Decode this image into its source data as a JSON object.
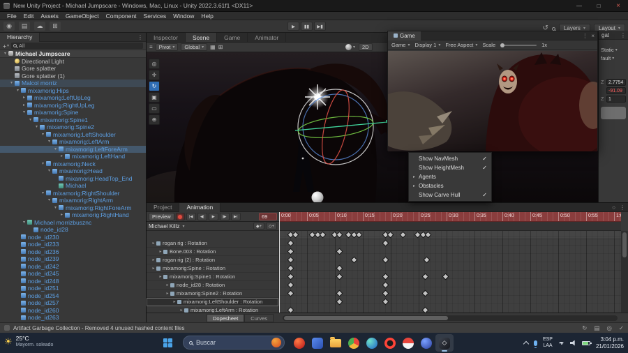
{
  "window": {
    "title": "New Unity Project - Michael Jumpscare - Windows, Mac, Linux - Unity 2022.3.61f1 <DX11>"
  },
  "icons": {
    "caret": "▾",
    "fold": "▸",
    "menu": "⋮",
    "close": "×",
    "minimize": "—",
    "maximize": "□",
    "check": "✓",
    "history": "↺",
    "hamburger": "≡",
    "plus": "+",
    "grid_snap": "▦",
    "increment_snap": "⊞",
    "key_add": "◆+",
    "event_add": "◇+",
    "lock": "○"
  },
  "menu_bar": {
    "items": [
      "File",
      "Edit",
      "Assets",
      "GameObject",
      "Component",
      "Services",
      "Window",
      "Help"
    ]
  },
  "toolbar": {
    "left_icons": [
      {
        "name": "account-icon",
        "glyph": "◉"
      },
      {
        "name": "services-icon",
        "glyph": "▤"
      },
      {
        "name": "cloud-icon",
        "glyph": "☁"
      },
      {
        "name": "grid-tool-icon",
        "glyph": "⊞"
      }
    ],
    "transport": [
      {
        "name": "play-button",
        "glyph": "▶"
      },
      {
        "name": "pause-button",
        "glyph": "▮▮"
      },
      {
        "name": "step-button",
        "glyph": "▶▮"
      }
    ],
    "layers_label": "Layers",
    "layout_label": "Layout"
  },
  "view_tabs": [
    {
      "label": "Inspector",
      "active": false
    },
    {
      "label": "Scene",
      "active": true
    },
    {
      "label": "Game",
      "active": false
    },
    {
      "label": "Animator",
      "active": false
    }
  ],
  "scene_toolbar": {
    "pivot_label": "Pivot",
    "global_label": "Global",
    "two_d_label": "2D"
  },
  "scene_tools": [
    {
      "name": "view-tool",
      "glyph": "◎",
      "active": false
    },
    {
      "name": "move-tool",
      "glyph": "✛",
      "active": false
    },
    {
      "name": "rotate-tool",
      "glyph": "↻",
      "active": true
    },
    {
      "name": "scale-tool",
      "glyph": "▣",
      "active": false
    },
    {
      "name": "rect-tool",
      "glyph": "▭",
      "active": false
    },
    {
      "name": "transform-tool",
      "glyph": "⊕",
      "active": false
    }
  ],
  "hierarchy": {
    "title": "Hierarchy",
    "search_value": "All",
    "items": [
      {
        "label": "Michael Jumpscare",
        "depth": 0,
        "arrow": "▾",
        "icon": "scene",
        "bold": true
      },
      {
        "label": "Directional Light",
        "depth": 1,
        "icon": "light"
      },
      {
        "label": "Gore splatter",
        "depth": 1,
        "icon": "go"
      },
      {
        "label": "Gore splatter (1)",
        "depth": 1,
        "icon": "go"
      },
      {
        "label": "Malcol morriz",
        "depth": 1,
        "arrow": "▾",
        "icon": "prefab",
        "prefab": true,
        "highlight": true
      },
      {
        "label": "mixamorig:Hips",
        "depth": 2,
        "arrow": "▾",
        "icon": "prefab",
        "prefab": true
      },
      {
        "label": "mixamorig:LeftUpLeg",
        "depth": 3,
        "arrow": "▸",
        "icon": "prefab",
        "prefab": true
      },
      {
        "label": "mixamorig:RightUpLeg",
        "depth": 3,
        "arrow": "▸",
        "icon": "prefab",
        "prefab": true
      },
      {
        "label": "mixamorig:Spine",
        "depth": 3,
        "arrow": "▾",
        "icon": "prefab",
        "prefab": true
      },
      {
        "label": "mixamorig:Spine1",
        "depth": 4,
        "arrow": "▾",
        "icon": "prefab",
        "prefab": true
      },
      {
        "label": "mixamorig:Spine2",
        "depth": 5,
        "arrow": "▾",
        "icon": "prefab",
        "prefab": true
      },
      {
        "label": "mixamorig:LeftShoulder",
        "depth": 6,
        "arrow": "▾",
        "icon": "prefab",
        "prefab": true
      },
      {
        "label": "mixamorig:LeftArm",
        "depth": 7,
        "arrow": "▾",
        "icon": "prefab",
        "prefab": true
      },
      {
        "label": "mixamorig:LeftForeArm",
        "depth": 8,
        "arrow": "▾",
        "icon": "prefab",
        "prefab": true,
        "selected": true
      },
      {
        "label": "mixamorig:LeftHand",
        "depth": 9,
        "arrow": "▸",
        "icon": "prefab",
        "prefab": true
      },
      {
        "label": "mixamorig:Neck",
        "depth": 6,
        "arrow": "▾",
        "icon": "prefab",
        "prefab": true
      },
      {
        "label": "mixamorig:Head",
        "depth": 7,
        "arrow": "▾",
        "icon": "prefab",
        "prefab": true
      },
      {
        "label": "mixamorig:HeadTop_End",
        "depth": 8,
        "icon": "prefab",
        "prefab": true
      },
      {
        "label": "Michael",
        "depth": 8,
        "icon": "mesh",
        "prefab": true
      },
      {
        "label": "mixamorig:RightShoulder",
        "depth": 6,
        "arrow": "▾",
        "icon": "prefab",
        "prefab": true
      },
      {
        "label": "mixamorig:RightArm",
        "depth": 7,
        "arrow": "▾",
        "icon": "prefab",
        "prefab": true
      },
      {
        "label": "mixamorig:RightForeArm",
        "depth": 8,
        "arrow": "▾",
        "icon": "prefab",
        "prefab": true
      },
      {
        "label": "mixamorig:RightHand",
        "depth": 9,
        "arrow": "▸",
        "icon": "prefab",
        "prefab": true
      },
      {
        "label": "Michael morrizbusznc",
        "depth": 3,
        "arrow": "▾",
        "icon": "mesh",
        "prefab": true
      },
      {
        "label": "node_id28",
        "depth": 4,
        "icon": "prefab",
        "prefab": true
      },
      {
        "label": "node_id230",
        "depth": 2,
        "icon": "prefab",
        "prefab": true
      },
      {
        "label": "node_id233",
        "depth": 2,
        "icon": "prefab",
        "prefab": true
      },
      {
        "label": "node_id236",
        "depth": 2,
        "icon": "prefab",
        "prefab": true
      },
      {
        "label": "node_id239",
        "depth": 2,
        "icon": "prefab",
        "prefab": true
      },
      {
        "label": "node_id242",
        "depth": 2,
        "icon": "prefab",
        "prefab": true
      },
      {
        "label": "node_id245",
        "depth": 2,
        "icon": "prefab",
        "prefab": true
      },
      {
        "label": "node_id248",
        "depth": 2,
        "icon": "prefab",
        "prefab": true
      },
      {
        "label": "node_id251",
        "depth": 2,
        "icon": "prefab",
        "prefab": true
      },
      {
        "label": "node_id254",
        "depth": 2,
        "icon": "prefab",
        "prefab": true
      },
      {
        "label": "node_id257",
        "depth": 2,
        "icon": "prefab",
        "prefab": true
      },
      {
        "label": "node_id260",
        "depth": 2,
        "icon": "prefab",
        "prefab": true
      },
      {
        "label": "node_id263",
        "depth": 2,
        "icon": "prefab",
        "prefab": true
      }
    ]
  },
  "game_window": {
    "tab_label": "Game",
    "mode_label": "Game",
    "display_label": "Display 1",
    "aspect_label": "Free Aspect",
    "scale_label": "Scale",
    "scale_value": "1x"
  },
  "navmesh_menu": {
    "items": [
      {
        "label": "Show NavMesh",
        "checked": true,
        "fold": false
      },
      {
        "label": "Show HeightMesh",
        "checked": true,
        "fold": false
      },
      {
        "label": "Agents",
        "checked": false,
        "fold": true
      },
      {
        "label": "Obstacles",
        "checked": false,
        "fold": true
      },
      {
        "label": "Show Carve Hull",
        "checked": true,
        "fold": false
      }
    ]
  },
  "inspector": {
    "tab_fragment": "gat",
    "static_label": "Static",
    "layer_fragment": "fault",
    "fields": [
      {
        "label": "Z",
        "value": "2.7754",
        "red": false
      },
      {
        "label": "",
        "value": "-91.09",
        "red": true
      },
      {
        "label": "Z",
        "value": "1",
        "red": false
      }
    ]
  },
  "bottom_panel": {
    "tabs": [
      {
        "label": "Project",
        "active": false
      },
      {
        "label": "Animation",
        "active": true
      }
    ],
    "animation": {
      "preview_label": "Preview",
      "frame_value": "69",
      "clip_name": "Michael Killz",
      "transport": [
        {
          "name": "goto-start-button",
          "glyph": "|◀"
        },
        {
          "name": "prev-key-button",
          "glyph": "◀|"
        },
        {
          "name": "play-button",
          "glyph": "▶"
        },
        {
          "name": "next-key-button",
          "glyph": "|▶"
        },
        {
          "name": "goto-end-button",
          "glyph": "▶|"
        }
      ],
      "ruler_labels": [
        "0:00",
        "0:05",
        "0:10",
        "0:15",
        "0:20",
        "0:25",
        "0:30",
        "0:35",
        "0:40",
        "0:45",
        "0:50",
        "0:55",
        "1:0"
      ],
      "tracks": [
        {
          "label": "rogan rig : Rotation",
          "depth": 0
        },
        {
          "label": "Bone.003 : Rotation",
          "depth": 1
        },
        {
          "label": "rogan rig (2) : Rotation",
          "depth": 0
        },
        {
          "label": "mixamorig:Spine : Rotation",
          "depth": 0
        },
        {
          "label": "mixamorig:Spine1 : Rotation",
          "depth": 1
        },
        {
          "label": "node_id28 : Rotation",
          "depth": 2
        },
        {
          "label": "mixamorig:Spine2 : Rotation",
          "depth": 2
        },
        {
          "label": "mixamorig:LeftShoulder : Rotation",
          "depth": 3,
          "boxed": true
        },
        {
          "label": "mixamorig:LeftArm : Rotation",
          "depth": 4
        }
      ],
      "keyframes": [
        {
          "row": -1,
          "x": [
            16,
            23,
            47,
            55,
            62,
            79,
            86,
            99,
            107,
            114,
            152,
            159,
            177,
            198,
            206,
            213
          ]
        },
        {
          "row": 0,
          "x": [
            16,
            152
          ]
        },
        {
          "row": 1,
          "x": [
            16,
            86
          ]
        },
        {
          "row": 2,
          "x": [
            16,
            107,
            152,
            211
          ]
        },
        {
          "row": 3,
          "x": [
            16,
            86
          ]
        },
        {
          "row": 4,
          "x": [
            16,
            86,
            152,
            209,
            238
          ]
        },
        {
          "row": 5,
          "x": [
            16,
            152
          ]
        },
        {
          "row": 6,
          "x": [
            16,
            86,
            152,
            209
          ]
        },
        {
          "row": 7,
          "x": [
            86,
            152
          ]
        },
        {
          "row": 8,
          "x": [
            16,
            209
          ]
        }
      ],
      "dopesheet_label": "Dopesheet",
      "curves_label": "Curves"
    }
  },
  "status_bar": {
    "message": "Artifact Garbage Collection - Removed 4 unused hashed content files",
    "right_icons": [
      {
        "name": "refresh-icon",
        "glyph": "↻"
      },
      {
        "name": "console-icon",
        "glyph": "▤"
      },
      {
        "name": "activity-icon",
        "glyph": "◎"
      },
      {
        "name": "ok-icon",
        "glyph": "✓"
      }
    ]
  },
  "taskbar": {
    "weather": {
      "temp": "25°C",
      "desc": "Mayorm. soleado"
    },
    "search_placeholder": "Buscar",
    "apps": [
      {
        "name": "taskbar-app-flame",
        "bg": "radial-gradient(circle at 35% 30%,#ff7a45,#b31217)",
        "shape": "round",
        "active": false
      },
      {
        "name": "taskbar-app-blue",
        "bg": "linear-gradient(135deg,#5a8cf0,#2a4fb0)",
        "shape": "square",
        "active": false
      },
      {
        "name": "taskbar-app-explorer",
        "bg": "linear-gradient(#ffd263,#e8a23c)",
        "shape": "folder",
        "active": false
      },
      {
        "name": "taskbar-app-chrome",
        "bg": "conic-gradient(#e8453c 0 33%,#f5b63c 33% 66%,#4caf50 66% 100%)",
        "shape": "round",
        "active": false
      },
      {
        "name": "taskbar-app-edge",
        "bg": "radial-gradient(circle at 30% 30%,#6ee0c8,#1e62c8)",
        "shape": "round",
        "active": false
      },
      {
        "name": "taskbar-app-opera",
        "bg": "radial-gradient(circle at 50% 50%,#1b1b1b 35%,#ff4438 42%)",
        "shape": "round",
        "active": false
      },
      {
        "name": "taskbar-app-ball",
        "bg": "linear-gradient(#e8453c 48%,#f5f5f5 52%)",
        "shape": "round",
        "active": false
      },
      {
        "name": "taskbar-app-social",
        "bg": "radial-gradient(circle at 35% 30%,#7aa0ff,#2b3f9e)",
        "shape": "round",
        "active": false
      },
      {
        "name": "taskbar-app-unity",
        "bg": "linear-gradient(135deg,#3c424d,#16181d)",
        "shape": "square",
        "glyph": "◇",
        "active": true
      }
    ],
    "tray": {
      "lang_line1": "ESP",
      "lang_line2": "LAA",
      "time": "3:04 p.m.",
      "date": "21/01/2026"
    }
  }
}
